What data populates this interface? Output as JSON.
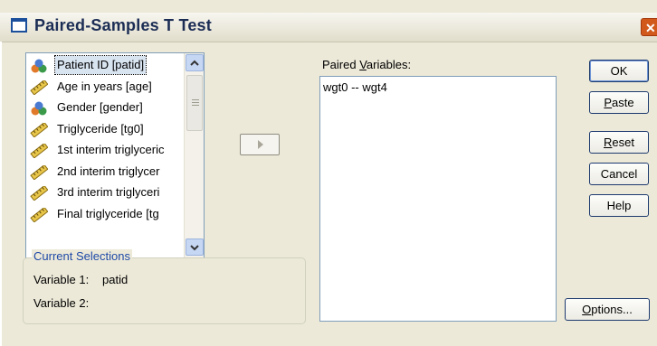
{
  "window": {
    "title": "Paired-Samples T Test",
    "close_glyph": "✕"
  },
  "variable_list": {
    "items": [
      {
        "label": "Patient ID [patid]",
        "icon": "nominal-icon",
        "selected": true
      },
      {
        "label": "Age in years [age]",
        "icon": "scale-icon",
        "selected": false
      },
      {
        "label": "Gender [gender]",
        "icon": "nominal-icon",
        "selected": false
      },
      {
        "label": "Triglyceride [tg0]",
        "icon": "scale-icon",
        "selected": false
      },
      {
        "label": "1st interim triglyceric",
        "icon": "scale-icon",
        "selected": false
      },
      {
        "label": "2nd interim triglycer",
        "icon": "scale-icon",
        "selected": false
      },
      {
        "label": "3rd interim triglyceri",
        "icon": "scale-icon",
        "selected": false
      },
      {
        "label": "Final triglyceride [tg",
        "icon": "scale-icon",
        "selected": false
      }
    ]
  },
  "paired_variables": {
    "label_pre": "Paired ",
    "label_u": "V",
    "label_post": "ariables:",
    "items": [
      "wgt0 -- wgt4"
    ]
  },
  "current_selections": {
    "legend": "Current Selections",
    "var1_label": "Variable 1:",
    "var1_value": "patid",
    "var2_label": "Variable 2:",
    "var2_value": ""
  },
  "buttons": {
    "ok": "OK",
    "paste_u": "P",
    "paste_rest": "aste",
    "reset_u": "R",
    "reset_rest": "eset",
    "cancel": "Cancel",
    "help": "Help",
    "options_u": "O",
    "options_rest": "ptions..."
  },
  "colors": {
    "accent": "#1f4aa8",
    "title_text": "#1c2d55",
    "close": "#d1591c"
  }
}
